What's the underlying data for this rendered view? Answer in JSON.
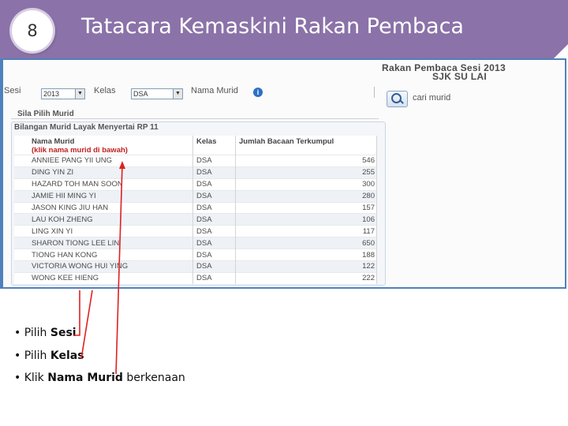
{
  "slide": {
    "number": "8",
    "title": "Tatacara Kemaskini Rakan Pembaca"
  },
  "screenshot": {
    "report_title": "Rakan Pembaca Sesi 2013",
    "report_subtitle": "SJK SU LAI",
    "filters": {
      "sesi_label": "Sesi",
      "sesi_value": "2013",
      "kelas_label": "Kelas",
      "kelas_value": "DSA",
      "nama_label": "Nama Murid",
      "search_label": "cari murid"
    },
    "section_heading": "Sila Pilih Murid",
    "panel_heading": "Bilangan Murid Layak Menyertai RP 11",
    "table": {
      "headers": {
        "name": "Nama Murid",
        "name_note": "(klik nama murid di bawah)",
        "kelas": "Kelas",
        "jumlah": "Jumlah Bacaan Terkumpul"
      },
      "rows": [
        {
          "name": "ANNIEE PANG YII UNG",
          "kelas": "DSA",
          "jumlah": "546"
        },
        {
          "name": "DING YIN ZI",
          "kelas": "DSA",
          "jumlah": "255"
        },
        {
          "name": "HAZARD TOH MAN SOON",
          "kelas": "DSA",
          "jumlah": "300"
        },
        {
          "name": "JAMIE HII MING YI",
          "kelas": "DSA",
          "jumlah": "280"
        },
        {
          "name": "JASON KING JIU HAN",
          "kelas": "DSA",
          "jumlah": "157"
        },
        {
          "name": "LAU KOH ZHENG",
          "kelas": "DSA",
          "jumlah": "106"
        },
        {
          "name": "LING XIN YI",
          "kelas": "DSA",
          "jumlah": "117"
        },
        {
          "name": "SHARON TIONG LEE LIN",
          "kelas": "DSA",
          "jumlah": "650"
        },
        {
          "name": "TIONG HAN KONG",
          "kelas": "DSA",
          "jumlah": "188"
        },
        {
          "name": "VICTORIA WONG HUI YING",
          "kelas": "DSA",
          "jumlah": "122"
        },
        {
          "name": "WONG KEE HIENG",
          "kelas": "DSA",
          "jumlah": "222"
        }
      ]
    }
  },
  "bullets": [
    {
      "prefix": "Pilih ",
      "bold": "Sesi",
      "suffix": ""
    },
    {
      "prefix": "Pilih ",
      "bold": "Kelas",
      "suffix": ""
    },
    {
      "prefix": "Klik ",
      "bold": "Nama Murid",
      "suffix": " berkenaan"
    }
  ],
  "colors": {
    "title_band": "#8b72a8",
    "frame_border": "#4f81bd",
    "arrow": "#e02020",
    "table_note": "#c02020"
  }
}
